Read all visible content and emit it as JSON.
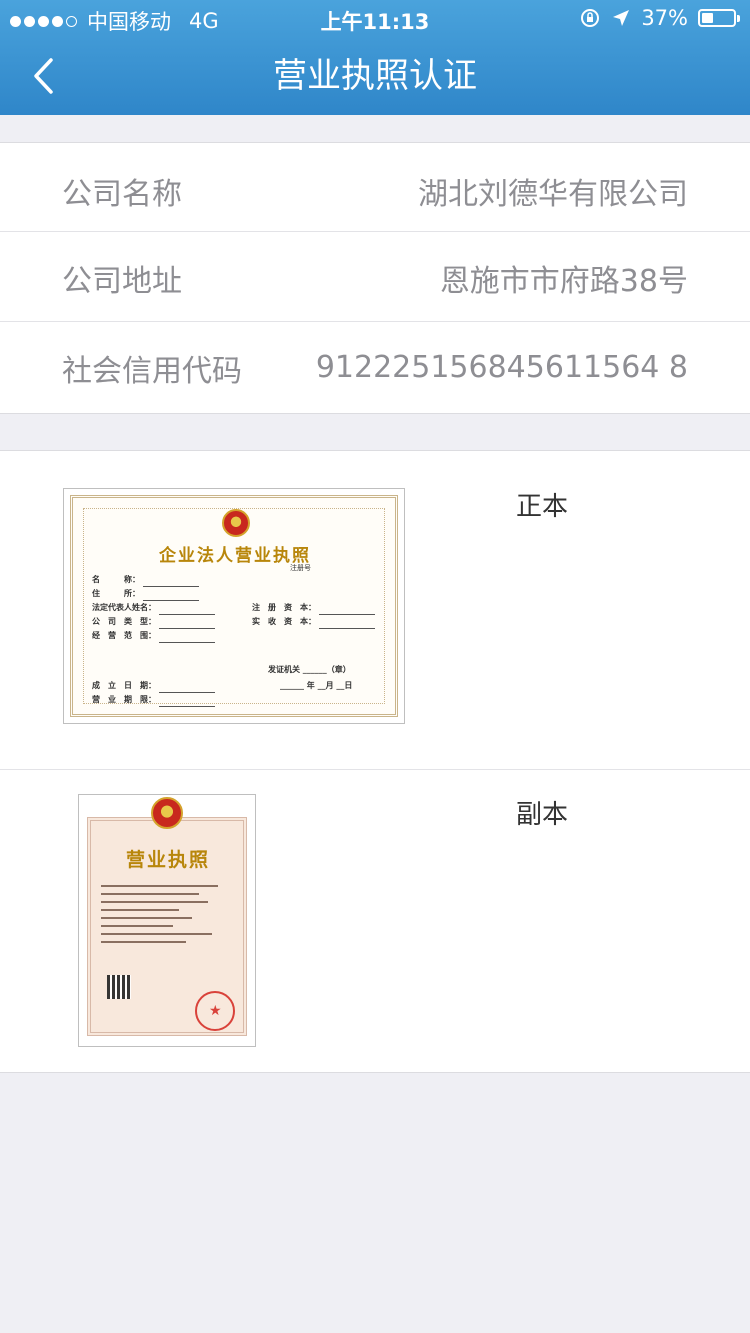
{
  "status_bar": {
    "carrier": "中国移动",
    "network": "4G",
    "time": "上午11:13",
    "battery": "37%",
    "battery_level": 0.37
  },
  "nav": {
    "title": "营业执照认证",
    "back_icon": "chevron-left-icon"
  },
  "company": {
    "rows": [
      {
        "label": "公司名称",
        "value": "湖北刘德华有限公司"
      },
      {
        "label": "公司地址",
        "value": "恩施市市府路38号"
      },
      {
        "label": "社会信用代码",
        "value": "912225156845611564 8"
      }
    ]
  },
  "licenses": {
    "original": {
      "label": "正本",
      "cert_title": "企业法人营业执照",
      "reg_no": "注册号",
      "fields": [
        "名　　　称：",
        "住　　　所：",
        "法定代表人姓名：",
        "公　司　类　型：",
        "经　营　范　围："
      ],
      "right_fields": [
        "注　册　资　本：",
        "实　收　资　本："
      ],
      "issuer": "发证机关 ______（章）",
      "date": "______ 年 __月 __日",
      "bottom_fields": [
        "成　立　日　期：",
        "营　业　期　限："
      ]
    },
    "copy": {
      "label": "副本",
      "cert_title": "营业执照"
    }
  },
  "colors": {
    "header_top": "#4aa3dc",
    "header_bottom": "#2f86c9",
    "background": "#efeff4"
  }
}
